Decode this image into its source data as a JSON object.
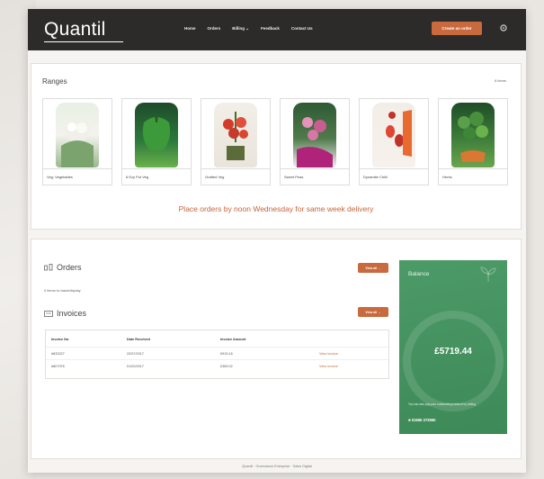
{
  "nav": {
    "logo": "Quantil",
    "links": [
      "Home",
      "Orders",
      "Billing ⌄",
      "Feedback",
      "Contact Us"
    ],
    "cta": "Create an order"
  },
  "ranges": {
    "title": "Ranges",
    "count": "6 items",
    "products": [
      {
        "label": "Veg: Vegetables",
        "colors": [
          "#e8efe3",
          "#f3f3ee",
          "#9ab88e"
        ]
      },
      {
        "label": "6 Ezy Pot Veg",
        "colors": [
          "#1d4b2a",
          "#2e7a3c",
          "#6ab24a"
        ]
      },
      {
        "label": "Grafted Veg",
        "colors": [
          "#5b6b3a",
          "#c43a2b",
          "#e2513a"
        ]
      },
      {
        "label": "Sweet Peas",
        "colors": [
          "#2e5a35",
          "#c85d91",
          "#e493b9"
        ]
      },
      {
        "label": "Dynamite Chilli",
        "colors": [
          "#f2ede7",
          "#c1322a",
          "#e04633"
        ]
      },
      {
        "label": "Herbs",
        "colors": [
          "#1f4d27",
          "#3d7d3a",
          "#6aa54d"
        ]
      }
    ],
    "notice": "Place orders by noon Wednesday for same week delivery"
  },
  "orders": {
    "title": "Orders",
    "button": "View all →",
    "empty": "0 items to track/display"
  },
  "invoices": {
    "title": "Invoices",
    "button": "View all →",
    "columns": [
      "Invoice No.",
      "Date Received",
      "Invoice Amount"
    ],
    "rows": [
      {
        "no": "#833227",
        "date": "22/07/2017",
        "amount": "£915.16",
        "action": "View invoice"
      },
      {
        "no": "#807976",
        "date": "01/02/2017",
        "amount": "£389.02",
        "action": "View invoice"
      }
    ]
  },
  "balance": {
    "title": "Balance",
    "amount": "£5719.44",
    "note": "You can also pay your outstanding balance by calling",
    "phone": "01865 373960"
  },
  "footer": "Quantil · Greenstock Enterprise · Sales Digital"
}
